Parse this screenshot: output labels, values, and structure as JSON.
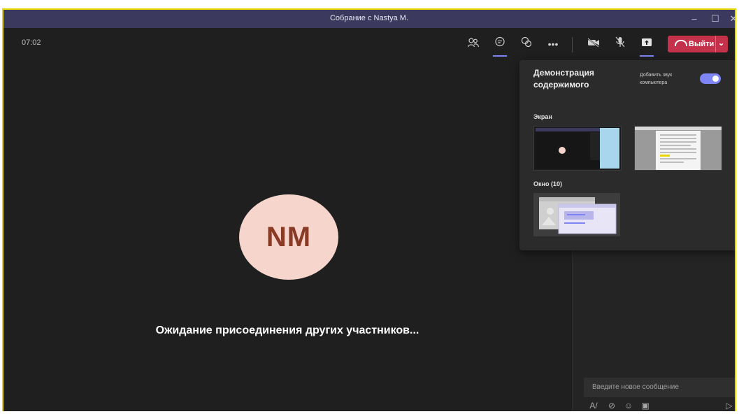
{
  "window": {
    "title": "Собрание с Nastya M."
  },
  "toolbar": {
    "time": "07:02",
    "leave_label": "Выйти"
  },
  "stage": {
    "avatar_initials": "NM",
    "waiting_text": "Ожидание присоединения других участников..."
  },
  "share_panel": {
    "title": "Демонстрация содержимого",
    "include_sound_label": "Добавить звук компьютера",
    "include_sound_on": true,
    "screen_section": "Экран",
    "windows_section": "Окно (10)"
  },
  "chat": {
    "placeholder": "Введите новое сообщение"
  },
  "colors": {
    "titlebar": "#3b3a5e",
    "accent": "#7f85f5",
    "leave": "#c4314b",
    "avatar_bg": "#f5d5cc",
    "avatar_text": "#8a3b26"
  }
}
